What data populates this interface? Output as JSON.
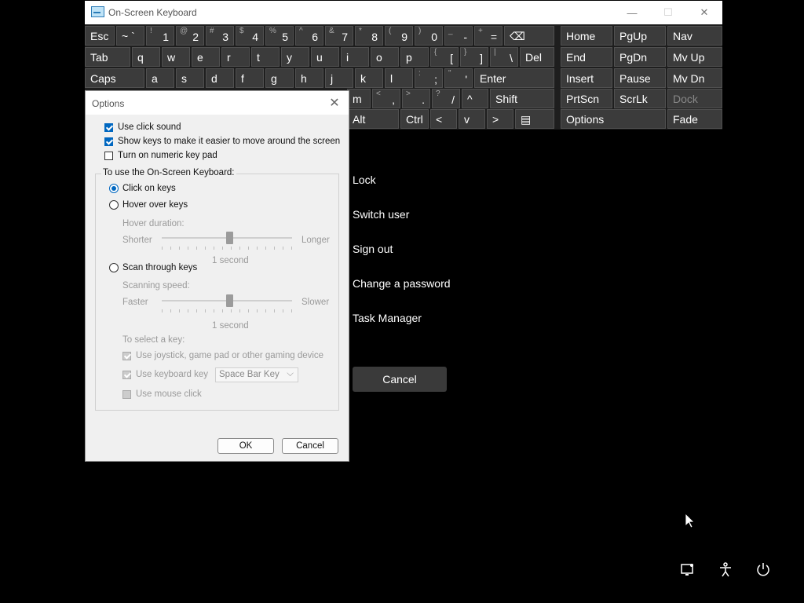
{
  "menu": {
    "items": [
      "Lock",
      "Switch user",
      "Sign out",
      "Change a password",
      "Task Manager"
    ],
    "cancel": "Cancel"
  },
  "osk": {
    "title": "On-Screen Keyboard",
    "rows": [
      [
        {
          "m": "Esc"
        },
        {
          "m": "~ `"
        },
        {
          "s": "!",
          "m": "1"
        },
        {
          "s": "@",
          "m": "2"
        },
        {
          "s": "#",
          "m": "3"
        },
        {
          "s": "$",
          "m": "4"
        },
        {
          "s": "%",
          "m": "5"
        },
        {
          "s": "^",
          "m": "6"
        },
        {
          "s": "&",
          "m": "7"
        },
        {
          "s": "*",
          "m": "8"
        },
        {
          "s": "(",
          "m": "9"
        },
        {
          "s": ")",
          "m": "0"
        },
        {
          "s": "_",
          "m": "-"
        },
        {
          "s": "+",
          "m": "="
        },
        {
          "m": "⌫"
        }
      ],
      [
        {
          "m": "Tab"
        },
        {
          "m": "q"
        },
        {
          "m": "w"
        },
        {
          "m": "e"
        },
        {
          "m": "r"
        },
        {
          "m": "t"
        },
        {
          "m": "y"
        },
        {
          "m": "u"
        },
        {
          "m": "i"
        },
        {
          "m": "o"
        },
        {
          "m": "p"
        },
        {
          "s": "{",
          "m": "["
        },
        {
          "s": "}",
          "m": "]"
        },
        {
          "s": "|",
          "m": "\\"
        },
        {
          "m": "Del"
        }
      ],
      [
        {
          "m": "Caps"
        },
        {
          "m": "a"
        },
        {
          "m": "s"
        },
        {
          "m": "d"
        },
        {
          "m": "f"
        },
        {
          "m": "g"
        },
        {
          "m": "h"
        },
        {
          "m": "j"
        },
        {
          "m": "k"
        },
        {
          "m": "l"
        },
        {
          "s": ":",
          "m": ";"
        },
        {
          "s": "\"",
          "m": "'"
        },
        {
          "m": "Enter"
        }
      ],
      [
        {
          "m": "m"
        },
        {
          "s": "<",
          "m": ","
        },
        {
          "s": ">",
          "m": "."
        },
        {
          "s": "?",
          "m": "/"
        },
        {
          "m": "^"
        },
        {
          "m": "Shift"
        }
      ],
      [
        {
          "m": "Alt"
        },
        {
          "m": "Ctrl"
        },
        {
          "m": "<"
        },
        {
          "m": "v"
        },
        {
          "m": ">"
        },
        {
          "m": "▤"
        }
      ]
    ],
    "nav": [
      [
        "Home",
        "PgUp",
        "Nav"
      ],
      [
        "End",
        "PgDn",
        "Mv Up"
      ],
      [
        "Insert",
        "Pause",
        "Mv Dn"
      ],
      [
        "PrtScn",
        "ScrLk",
        "Dock"
      ],
      [
        "Options",
        "Fade"
      ]
    ]
  },
  "dialog": {
    "title": "Options",
    "checks": [
      {
        "label": "Use click sound",
        "checked": true
      },
      {
        "label": "Show keys to make it easier to move around the screen",
        "checked": true
      },
      {
        "label": "Turn on numeric key pad",
        "checked": false
      }
    ],
    "group_label": "To use the On-Screen Keyboard:",
    "radios": [
      {
        "label": "Click on keys",
        "selected": true
      },
      {
        "label": "Hover over keys",
        "selected": false
      },
      {
        "label": "Scan through keys",
        "selected": false
      }
    ],
    "hover": {
      "label": "Hover duration:",
      "min": "Shorter",
      "max": "Longer",
      "value": "1 second"
    },
    "scan": {
      "label": "Scanning speed:",
      "min": "Faster",
      "max": "Slower",
      "value": "1 second"
    },
    "select_label": "To select a key:",
    "select_opts": [
      {
        "label": "Use joystick, game pad or other gaming device",
        "checked": true
      },
      {
        "label": "Use keyboard key",
        "checked": true
      },
      {
        "label": "Use mouse click",
        "checked": false
      }
    ],
    "key_value": "Space Bar Key",
    "ok": "OK",
    "cancel": "Cancel"
  }
}
